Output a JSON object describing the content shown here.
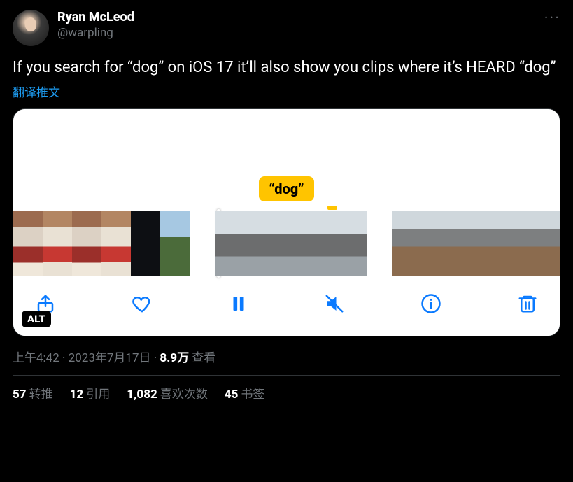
{
  "author": {
    "display_name": "Ryan McLeod",
    "handle": "@warpling"
  },
  "body": "If you search for “dog” on iOS 17 it’ll also show you clips where it’s HEARD “dog”",
  "translate_label": "翻译推文",
  "media": {
    "badge": "“dog”",
    "alt_label": "ALT",
    "toolbar": {
      "share": "share-icon",
      "like": "heart-icon",
      "pause": "pause-icon",
      "mute": "muted-icon",
      "info": "info-icon",
      "trash": "trash-icon"
    }
  },
  "meta": {
    "time": "上午4:42",
    "sep1": " · ",
    "date": "2023年7月17日",
    "sep2": " · ",
    "views_count": "8.9万",
    "views_label": " 查看"
  },
  "stats": {
    "retweets": {
      "n": "57",
      "label": "转推"
    },
    "quotes": {
      "n": "12",
      "label": "引用"
    },
    "likes": {
      "n": "1,082",
      "label": "喜欢次数"
    },
    "bookmarks": {
      "n": "45",
      "label": "书签"
    }
  }
}
